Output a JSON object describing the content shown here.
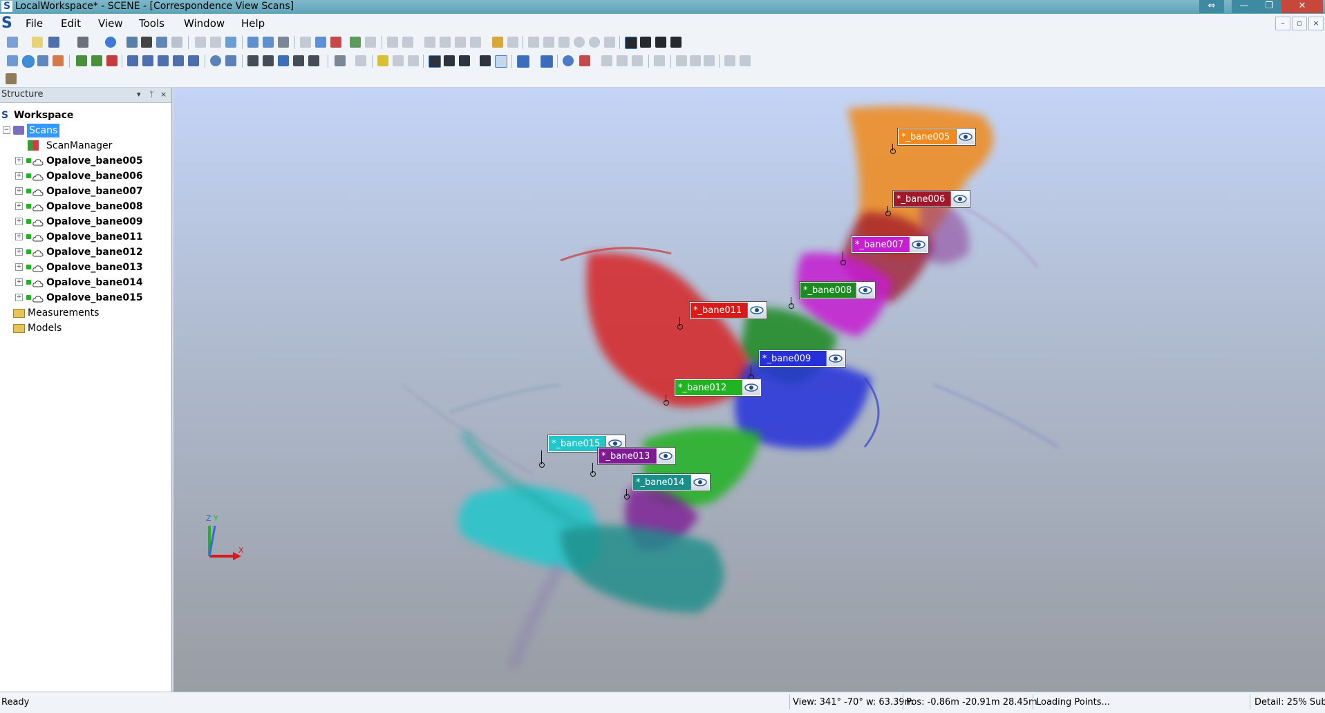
{
  "window": {
    "title": "LocalWorkspace* - SCENE - [Correspondence View Scans]",
    "controls": [
      "⇔",
      "—",
      "❐",
      "✕"
    ]
  },
  "menu": {
    "items": [
      "File",
      "Edit",
      "View",
      "Tools",
      "Window",
      "Help"
    ],
    "mdi_controls": [
      "–",
      "▫",
      "×"
    ]
  },
  "structure_panel": {
    "title": "Structure",
    "header_buttons": [
      "▾",
      "ᛘ",
      "×"
    ],
    "workspace": "Workspace",
    "scans": "Scans",
    "scan_manager": "ScanManager",
    "scan_items": [
      "Opalove_bane005",
      "Opalove_bane006",
      "Opalove_bane007",
      "Opalove_bane008",
      "Opalove_bane009",
      "Opalove_bane011",
      "Opalove_bane012",
      "Opalove_bane013",
      "Opalove_bane014",
      "Opalove_bane015"
    ],
    "measurements": "Measurements",
    "models": "Models"
  },
  "viewport": {
    "scan_labels": [
      {
        "text": "*_bane005",
        "color": "#f08a1e"
      },
      {
        "text": "*_bane006",
        "color": "#a0182a"
      },
      {
        "text": "*_bane007",
        "color": "#c51fd0"
      },
      {
        "text": "*_bane008",
        "color": "#1c8a20"
      },
      {
        "text": "*_bane011",
        "color": "#d81a1a"
      },
      {
        "text": "*_bane009",
        "color": "#2630d9"
      },
      {
        "text": "*_bane012",
        "color": "#22b322"
      },
      {
        "text": "*_bane015",
        "color": "#22c7cc"
      },
      {
        "text": "*_bane013",
        "color": "#7d1b94"
      },
      {
        "text": "*_bane014",
        "color": "#1b8e8a"
      }
    ],
    "axes": {
      "z": "Z",
      "y": "Y",
      "x": "X"
    }
  },
  "statusbar": {
    "ready": "Ready",
    "view": "View: 341° -70° w: 63.39m",
    "pos": "Pos: -0.86m -20.91m 28.45m",
    "loading": "Loading Points...",
    "detail": "Detail:  25%  Sub"
  }
}
